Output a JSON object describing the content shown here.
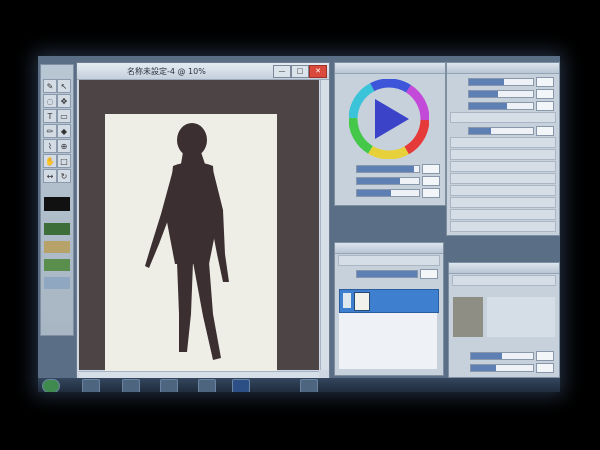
{
  "canvas_window": {
    "title": "名称未設定-4 @ 10%",
    "minimize_icon": "minimize-icon",
    "close_icon": "close-icon"
  },
  "toolbox": {
    "tools": [
      "pen-tool-icon",
      "select-tool-icon",
      "lasso-tool-icon",
      "move-tool-icon",
      "text-tool-icon",
      "eraser-tool-icon",
      "brush-tool-icon",
      "fill-tool-icon",
      "eyedropper-tool-icon",
      "zoom-tool-icon",
      "hand-tool-icon",
      "shape-tool-icon"
    ],
    "swatch_colors": [
      "#1a1a1a",
      "#3d6e3a",
      "#b7a26a",
      "#5a8e4c"
    ]
  },
  "color_panel": {
    "icon": "color-wheel-icon",
    "sliders": [
      0.92,
      0.7,
      0.55
    ]
  },
  "brush_panel": {
    "sliders": [
      0.55,
      0.45,
      0.6,
      0.35
    ]
  },
  "layer_panel": {
    "selected_layer_color": "#3f7fd0"
  },
  "taskbar": {
    "icons": [
      "start-icon",
      "explorer-icon",
      "browser-icon",
      "paint-app-icon",
      "photoshop-icon",
      "folder-icon",
      "media-icon"
    ]
  },
  "colors": {
    "screen_blue": "#5a6e86",
    "panel_bg": "#c6d1dc",
    "accent": "#5d7fb3"
  }
}
